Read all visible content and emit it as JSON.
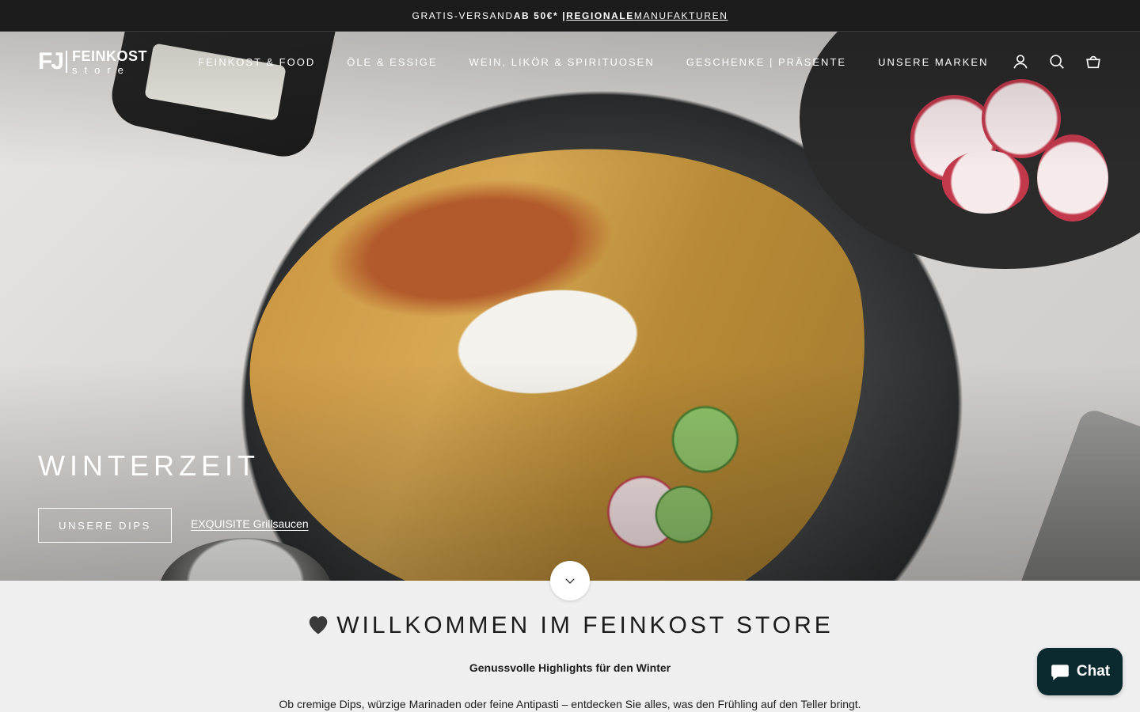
{
  "announcement": {
    "part1": "GRATIS-VERSAND ",
    "part2": "AB 50€* | ",
    "part3": "REGIONALE",
    "part4": " MANUFAKTUREN"
  },
  "header": {
    "logo_mark": "FJ",
    "logo_line1": "FEINKOST",
    "logo_line2": "store",
    "nav": [
      "FEINKOST & FOOD",
      "ÖLE & ESSIGE",
      "WEIN, LIKÖR & SPIRITUOSEN",
      "GESCHENKE | PRÄSENTE",
      "UNSERE MARKEN"
    ],
    "icons": [
      "account-icon",
      "search-icon",
      "cart-icon"
    ]
  },
  "hero": {
    "title": "WINTERZEIT",
    "button": "UNSERE DIPS",
    "link": "EXQUISITE Grillsaucen"
  },
  "welcome": {
    "title": "WILLKOMMEN IM FEINKOST STORE",
    "subtitle": "Genussvolle Highlights für den Winter",
    "text": "Ob cremige Dips, würzige Marinaden oder feine Antipasti – entdecken Sie alles, was den Frühling auf den Teller bringt."
  },
  "chat": {
    "label": "Chat"
  },
  "colors": {
    "dark": "#1c1c1c",
    "chat_bg": "#0b2a2f",
    "page_bg": "#efefef"
  }
}
